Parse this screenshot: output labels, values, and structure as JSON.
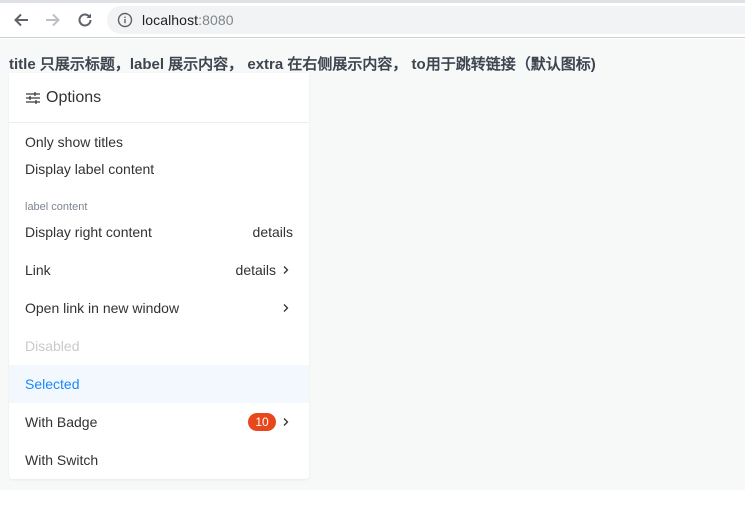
{
  "browser": {
    "url_host": "localhost",
    "url_port": ":8080"
  },
  "page": {
    "heading": "title 只展示标题，label 展示内容， extra 在右侧展示内容， to用于跳转链接（默认图标)"
  },
  "panel": {
    "title": "Options",
    "icon": "sliders-icon",
    "cells": [
      {
        "title": "Only show titles"
      },
      {
        "title": "Display label content",
        "label": "label content"
      },
      {
        "title": "Display right content",
        "extra": "details"
      },
      {
        "title": "Link",
        "extra": "details",
        "arrow": true
      },
      {
        "title": "Open link in new window",
        "arrow": true
      },
      {
        "title": "Disabled",
        "disabled": true
      },
      {
        "title": "Selected",
        "selected": true
      },
      {
        "title": "With Badge",
        "badge": "10",
        "arrow": true
      },
      {
        "title": "With Switch"
      }
    ]
  },
  "colors": {
    "accent": "#1989fa",
    "badge": "#e8471c",
    "disabled": "#c8c9cc",
    "selected_bg": "#f2f8fe"
  }
}
